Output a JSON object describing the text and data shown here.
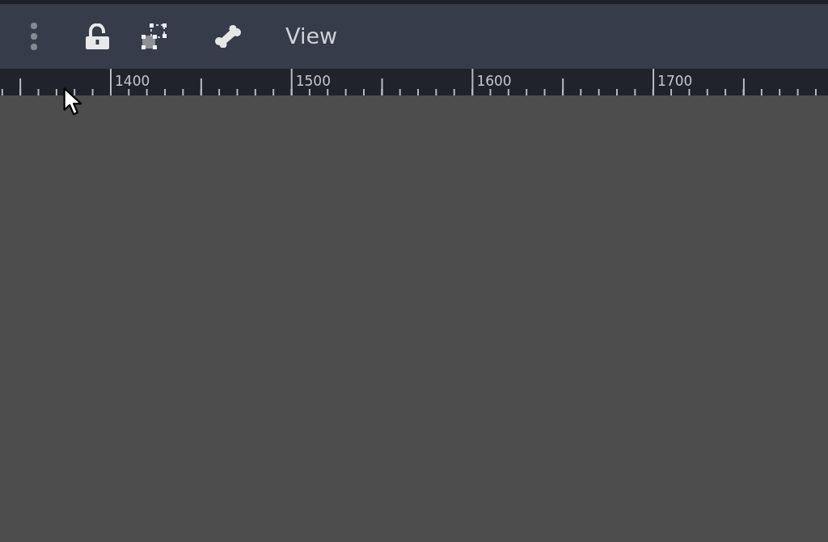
{
  "toolbar": {
    "menus": [
      {
        "label": "View"
      }
    ]
  },
  "ruler": {
    "labels": [
      "1400",
      "1500",
      "1600",
      "1700"
    ]
  }
}
